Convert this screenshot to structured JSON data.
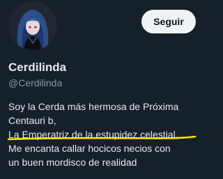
{
  "profile": {
    "display_name": "Cerdilinda",
    "handle": "@Cerdilinda",
    "follow_label": "Seguir",
    "bio_lines": [
      "Soy la Cerda más hermosa de Próxima",
      "Centauri b,",
      "La Emperatriz de la estupidez celestial,",
      "Me encanta callar hocicos necios con",
      "un buen mordisco de realidad"
    ]
  },
  "colors": {
    "background": "#15202b",
    "text": "#e7e9ea",
    "secondary_text": "#8b98a5",
    "button_bg": "#eff3f4",
    "highlight": "#ffe600"
  }
}
